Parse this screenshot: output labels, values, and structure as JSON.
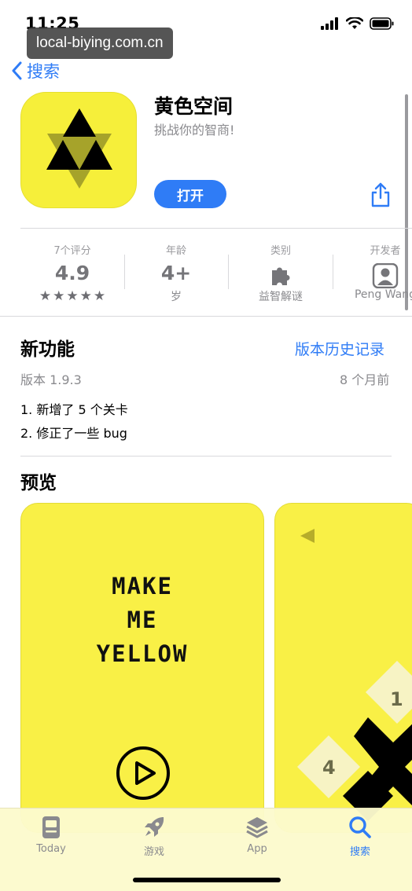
{
  "status_bar": {
    "time": "11:25"
  },
  "url_overlay": "local-biying.com.cn",
  "nav": {
    "back_label": "搜索"
  },
  "app": {
    "title": "黄色空间",
    "subtitle": "挑战你的智商!",
    "open_label": "打开",
    "icon_color": "#f6ef3a"
  },
  "info": {
    "ratings": {
      "head": "7个评分",
      "value": "4.9",
      "stars": 5
    },
    "age": {
      "head": "年龄",
      "value": "4+",
      "sub": "岁"
    },
    "category": {
      "head": "类别",
      "sub": "益智解谜",
      "icon": "puzzle-icon"
    },
    "developer": {
      "head": "开发者",
      "sub": "Peng Wang",
      "icon": "person-icon"
    }
  },
  "whats_new": {
    "title": "新功能",
    "history_link": "版本历史记录",
    "version": "版本 1.9.3",
    "date": "8 个月前",
    "notes": [
      "1. 新增了 5 个关卡",
      "2. 修正了一些 bug"
    ]
  },
  "preview": {
    "title": "预览",
    "screenshot1": {
      "line1": "MAKE",
      "line2": "ME",
      "line3": "YELLOW"
    },
    "screenshot2": {
      "num_top": "1",
      "num_left": "4"
    }
  },
  "tab_bar": {
    "tabs": [
      {
        "label": "Today",
        "icon": "today-icon",
        "active": false
      },
      {
        "label": "游戏",
        "icon": "rocket-icon",
        "active": false
      },
      {
        "label": "App",
        "icon": "layers-icon",
        "active": false
      },
      {
        "label": "搜索",
        "icon": "search-icon",
        "active": true
      }
    ]
  },
  "colors": {
    "accent": "#2f7cf6",
    "app_yellow": "#f6ef3a"
  }
}
